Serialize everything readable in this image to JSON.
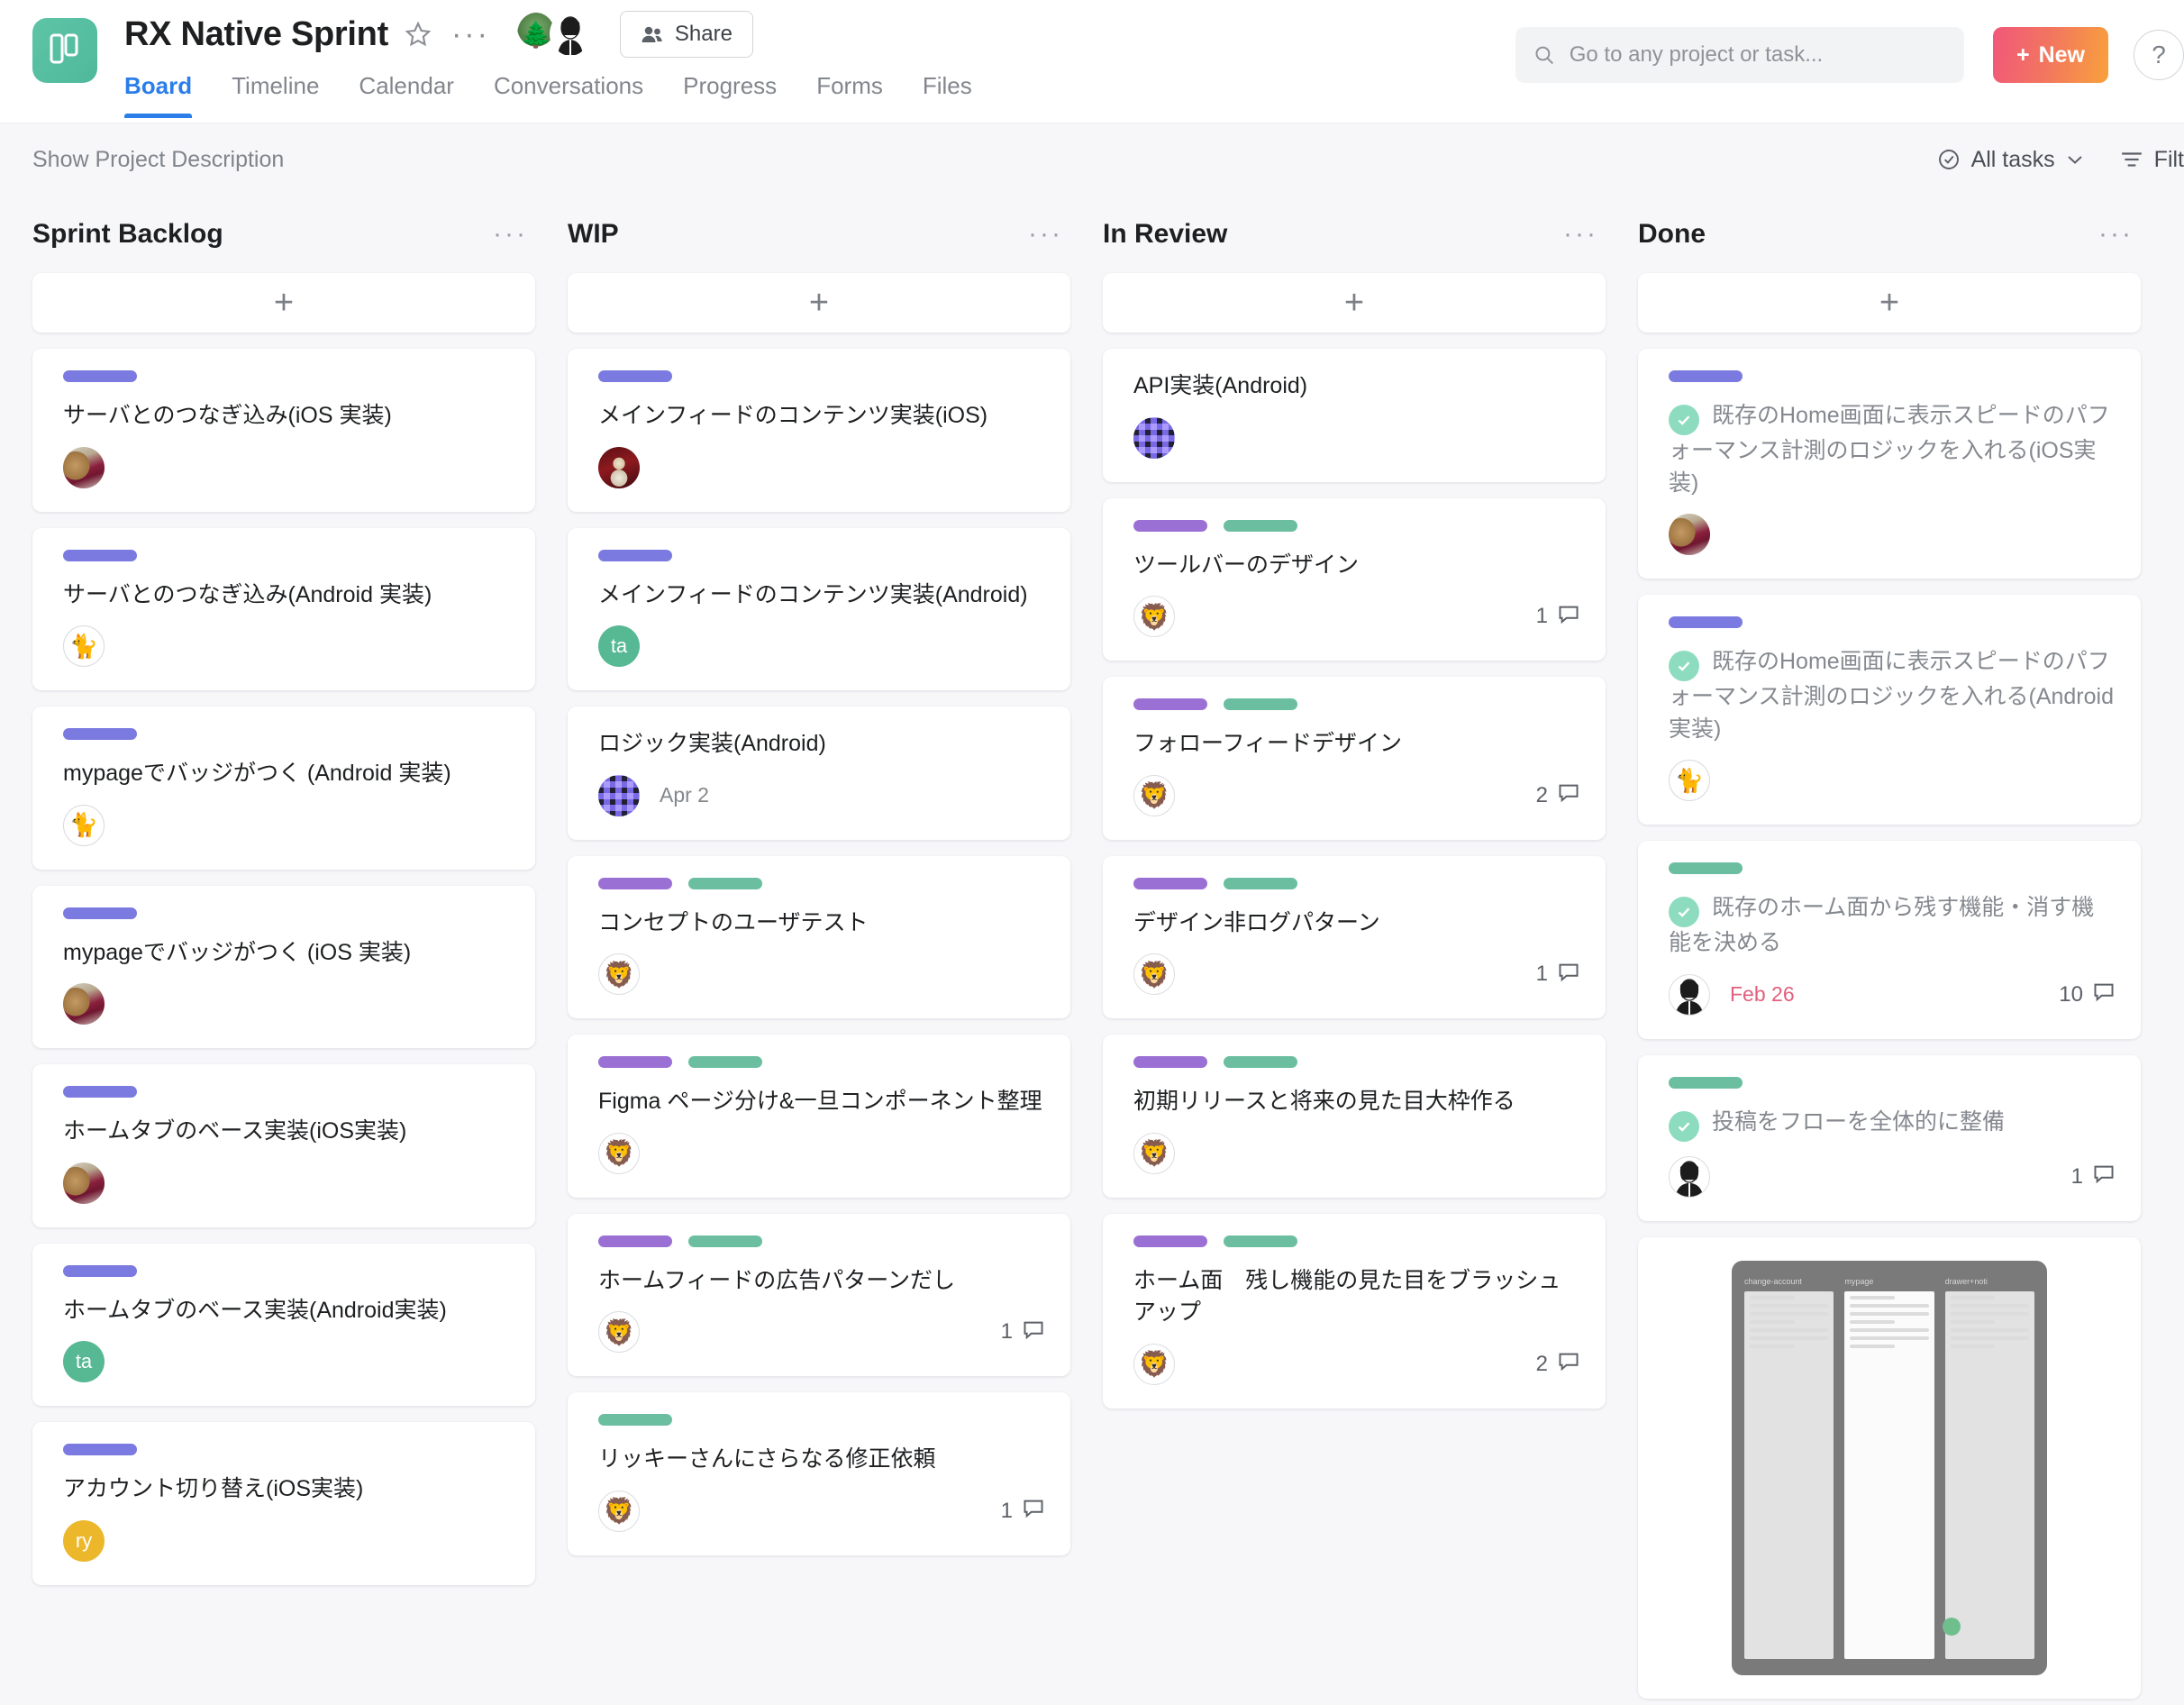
{
  "header": {
    "project_title": "RX Native Sprint",
    "star_icon": "star-outline-icon",
    "more_icon": "ellipsis-icon",
    "share_label": "Share",
    "members": [
      {
        "name": "bonsai-avatar",
        "glyph": "🌲"
      },
      {
        "name": "woman-avatar",
        "glyph": "👩"
      }
    ],
    "tabs": [
      {
        "label": "Board",
        "active": true
      },
      {
        "label": "Timeline",
        "active": false
      },
      {
        "label": "Calendar",
        "active": false
      },
      {
        "label": "Conversations",
        "active": false
      },
      {
        "label": "Progress",
        "active": false
      },
      {
        "label": "Forms",
        "active": false
      },
      {
        "label": "Files",
        "active": false
      }
    ],
    "search": {
      "placeholder": "Go to any project or task...",
      "value": ""
    },
    "new_button": "New",
    "help_button": "?"
  },
  "subbar": {
    "show_description": "Show Project Description",
    "all_tasks": "All tasks",
    "filter": "Filt"
  },
  "colors": {
    "tag_indigo": "#7b7ae0",
    "tag_purple": "#9b70d4",
    "tag_green": "#6bbfa0",
    "accent_blue": "#2b7de9",
    "overdue_red": "#e0607d",
    "check_green": "#8ddcc0"
  },
  "board": {
    "add_card_icon": "plus-icon",
    "column_menu_icon": "ellipsis-icon",
    "columns": [
      {
        "title": "Sprint Backlog",
        "cards": [
          {
            "title": "サーバとのつなぎ込み(iOS 実装)",
            "tags": [
              "indigo"
            ],
            "avatar": {
              "type": "photo-dog"
            }
          },
          {
            "title": "サーバとのつなぎ込み(Android 実装)",
            "tags": [
              "indigo"
            ],
            "avatar": {
              "type": "cat",
              "glyph": "🐈"
            }
          },
          {
            "title": "mypageでバッジがつく (Android 実装)",
            "tags": [
              "indigo"
            ],
            "avatar": {
              "type": "cat",
              "glyph": "🐈"
            }
          },
          {
            "title": "mypageでバッジがつく (iOS 実装)",
            "tags": [
              "indigo"
            ],
            "avatar": {
              "type": "photo-dog"
            }
          },
          {
            "title": "ホームタブのベース実装(iOS実装)",
            "tags": [
              "indigo"
            ],
            "avatar": {
              "type": "photo-dog"
            }
          },
          {
            "title": "ホームタブのベース実装(Android実装)",
            "tags": [
              "indigo"
            ],
            "avatar": {
              "type": "init-ta",
              "initials": "ta"
            }
          },
          {
            "title": "アカウント切り替え(iOS実装)",
            "tags": [
              "indigo"
            ],
            "avatar": {
              "type": "init-ry",
              "initials": "ry"
            }
          }
        ]
      },
      {
        "title": "WIP",
        "cards": [
          {
            "title": "メインフィードのコンテンツ実装(iOS)",
            "tags": [
              "indigo"
            ],
            "avatar": {
              "type": "maroon"
            }
          },
          {
            "title": "メインフィードのコンテンツ実装(Android)",
            "tags": [
              "indigo"
            ],
            "avatar": {
              "type": "init-ta",
              "initials": "ta"
            }
          },
          {
            "title": "ロジック実装(Android)",
            "tags": [],
            "avatar": {
              "type": "dark"
            },
            "due": "Apr 2"
          },
          {
            "title": "コンセプトのユーザテスト",
            "tags": [
              "purple",
              "green"
            ],
            "avatar": {
              "type": "lion",
              "glyph": "🦁"
            }
          },
          {
            "title": "Figma ページ分け&一旦コンポーネント整理",
            "tags": [
              "purple",
              "green"
            ],
            "avatar": {
              "type": "lion",
              "glyph": "🦁"
            }
          },
          {
            "title": "ホームフィードの広告パターンだし",
            "tags": [
              "purple",
              "green"
            ],
            "avatar": {
              "type": "lion",
              "glyph": "🦁"
            },
            "comments": "1"
          },
          {
            "title": "リッキーさんにさらなる修正依頼",
            "tags": [
              "green"
            ],
            "avatar": {
              "type": "lion",
              "glyph": "🦁"
            },
            "comments": "1"
          }
        ]
      },
      {
        "title": "In Review",
        "cards": [
          {
            "title": "API実装(Android)",
            "tags": [],
            "avatar": {
              "type": "dark"
            }
          },
          {
            "title": "ツールバーのデザイン",
            "tags": [
              "purple",
              "green"
            ],
            "avatar": {
              "type": "lion",
              "glyph": "🦁"
            },
            "comments": "1"
          },
          {
            "title": "フォローフィードデザイン",
            "tags": [
              "purple",
              "green"
            ],
            "avatar": {
              "type": "lion",
              "glyph": "🦁"
            },
            "comments": "2"
          },
          {
            "title": "デザイン非ログパターン",
            "tags": [
              "purple",
              "green"
            ],
            "avatar": {
              "type": "lion",
              "glyph": "🦁"
            },
            "comments": "1"
          },
          {
            "title": "初期リリースと将来の見た目大枠作る",
            "tags": [
              "purple",
              "green"
            ],
            "avatar": {
              "type": "lion",
              "glyph": "🦁"
            }
          },
          {
            "title": "ホーム面　残し機能の見た目をブラッシュアップ",
            "tags": [
              "purple",
              "green"
            ],
            "avatar": {
              "type": "lion",
              "glyph": "🦁"
            },
            "comments": "2"
          }
        ]
      },
      {
        "title": "Done",
        "cards": [
          {
            "title": "既存のHome画面に表示スピードのパフォーマンス計測のロジックを入れる(iOS実装)",
            "tags": [
              "indigo"
            ],
            "completed": true,
            "avatar": {
              "type": "photo-dog"
            }
          },
          {
            "title": "既存のHome画面に表示スピードのパフォーマンス計測のロジックを入れる(Android実装)",
            "tags": [
              "indigo"
            ],
            "completed": true,
            "avatar": {
              "type": "cat",
              "glyph": "🐈"
            }
          },
          {
            "title": "既存のホーム面から残す機能・消す機能を決める",
            "tags": [
              "green"
            ],
            "completed": true,
            "avatar": {
              "type": "woman",
              "glyph": "👩"
            },
            "due": "Feb 26",
            "overdue": true,
            "comments": "10"
          },
          {
            "title": "投稿をフローを全体的に整備",
            "tags": [
              "green"
            ],
            "completed": true,
            "avatar": {
              "type": "woman",
              "glyph": "👩"
            },
            "comments": "1"
          }
        ],
        "thumbnail_card": {
          "screens": [
            {
              "label": "change-account"
            },
            {
              "label": "mypage"
            },
            {
              "label": "drawer+noti"
            }
          ]
        }
      }
    ]
  }
}
